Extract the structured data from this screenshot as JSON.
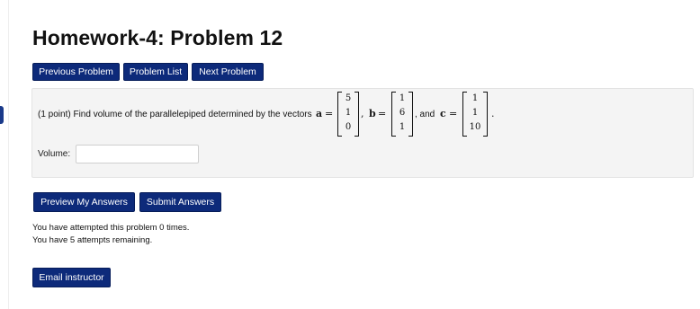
{
  "page": {
    "title": "Homework-4: Problem 12"
  },
  "nav": {
    "previous": "Previous Problem",
    "list": "Problem List",
    "next": "Next Problem"
  },
  "problem": {
    "points": "(1 point) Find volume of the parallelepiped determined by the vectors",
    "vector_a": {
      "name": "a",
      "entries": [
        "5",
        "1",
        "0"
      ]
    },
    "vector_b": {
      "name": "b",
      "entries": [
        "1",
        "6",
        "1"
      ]
    },
    "vector_c": {
      "name": "c",
      "entries": [
        "1",
        "1",
        "10"
      ]
    },
    "equals": "=",
    "comma": ",",
    "and": ", and",
    "period": "."
  },
  "answer": {
    "label": "Volume:",
    "value": ""
  },
  "actions": {
    "preview": "Preview My Answers",
    "submit": "Submit Answers"
  },
  "status": {
    "attempted": "You have attempted this problem 0 times.",
    "remaining": "You have 5 attempts remaining."
  },
  "footer": {
    "email": "Email instructor"
  }
}
